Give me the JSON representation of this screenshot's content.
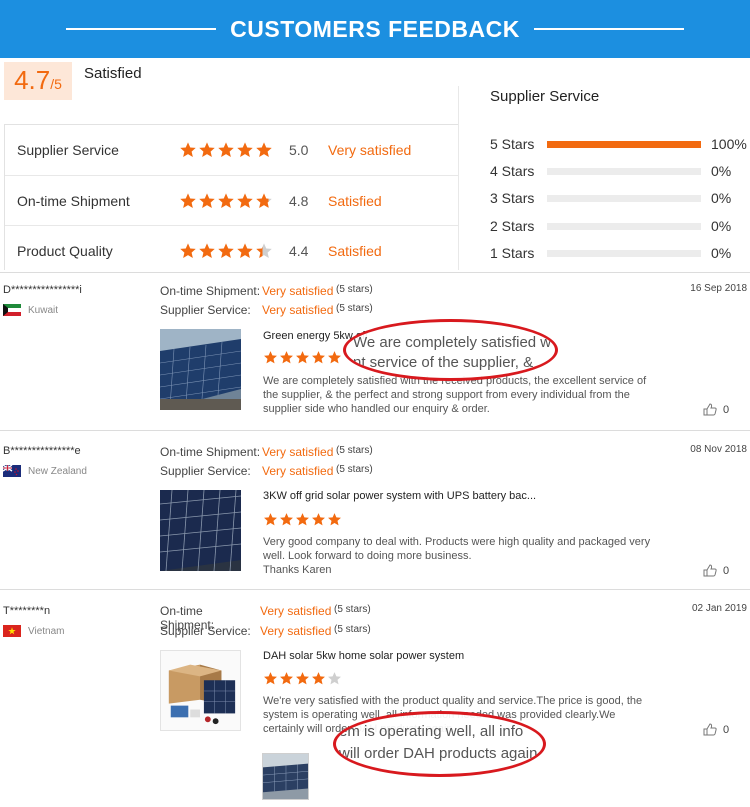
{
  "banner": {
    "title": "CUSTOMERS FEEDBACK"
  },
  "summary": {
    "score": "4.7",
    "out_of": "/5",
    "label": "Satisfied"
  },
  "ratings": [
    {
      "name": "Supplier Service",
      "stars": 5,
      "value": "5.0",
      "status": "Very satisfied"
    },
    {
      "name": "On-time Shipment",
      "stars": 4.8,
      "value": "4.8",
      "status": "Satisfied"
    },
    {
      "name": "Product Quality",
      "stars": 4.4,
      "value": "4.4",
      "status": "Satisfied"
    }
  ],
  "supplier_service": {
    "title": "Supplier Service",
    "rows": [
      {
        "label": "5  Stars",
        "fraction": 1.0,
        "pct": "100%"
      },
      {
        "label": "4  Stars",
        "fraction": 0,
        "pct": "0%"
      },
      {
        "label": "3  Stars",
        "fraction": 0,
        "pct": "0%"
      },
      {
        "label": "2  Stars",
        "fraction": 0,
        "pct": "0%"
      },
      {
        "label": "1  Stars",
        "fraction": 0,
        "pct": "0%"
      }
    ]
  },
  "colors": {
    "accent": "#f26a10",
    "banner": "#1c8fe0",
    "oval": "#d8191e"
  },
  "reviews": [
    {
      "name": "D****************i",
      "country": "Kuwait",
      "flag": "kuwait",
      "shipment_key": "On-time Shipment:",
      "shipment_value": "Very satisfied",
      "shipment_stars": "(5 stars)",
      "service_key": "Supplier Service:",
      "service_value": "Very satisfied",
      "service_stars": "(5 stars)",
      "date": "16 Sep 2018",
      "title": "Green energy 5kw off",
      "stars": 5,
      "body": "We are completely satisfied with the received products, the excellent service of the supplier, & the perfect and strong support from every individual from the supplier side who handled our enquiry & order.",
      "likes": "0",
      "zoom_line1": "We are completely satisfied w",
      "zoom_line2": "nt service of the supplier, &"
    },
    {
      "name": "B***************e",
      "country": "New Zealand",
      "flag": "nz",
      "shipment_key": "On-time Shipment:",
      "shipment_value": "Very satisfied",
      "shipment_stars": "(5 stars)",
      "service_key": "Supplier Service:",
      "service_value": "Very satisfied",
      "service_stars": "(5 stars)",
      "date": "08 Nov 2018",
      "title": "3KW off grid solar power system with UPS battery bac...",
      "stars": 5,
      "body": "Very good company to deal with. Products were high quality and packaged very well. Look forward to doing more business.\nThanks Karen",
      "likes": "0"
    },
    {
      "name": "T********n",
      "country": "Vietnam",
      "flag": "vietnam",
      "shipment_key": "On-time Shipment:",
      "shipment_value": "Very satisfied",
      "shipment_stars": "(5 stars)",
      "service_key": "Supplier Service:",
      "service_value": "Very satisfied",
      "service_stars": "(5 stars)",
      "date": "02 Jan 2019",
      "title": "DAH solar 5kw home solar power system",
      "stars": 4,
      "body": "We're very satisfied with the product quality and service.The price is good, the system is operating well, all information needed was provided clearly.We certainly will order DAH products again.",
      "likes": "0",
      "zoom_line1": "em is operating well, all info",
      "zoom_line2": "will order DAH products again"
    }
  ]
}
